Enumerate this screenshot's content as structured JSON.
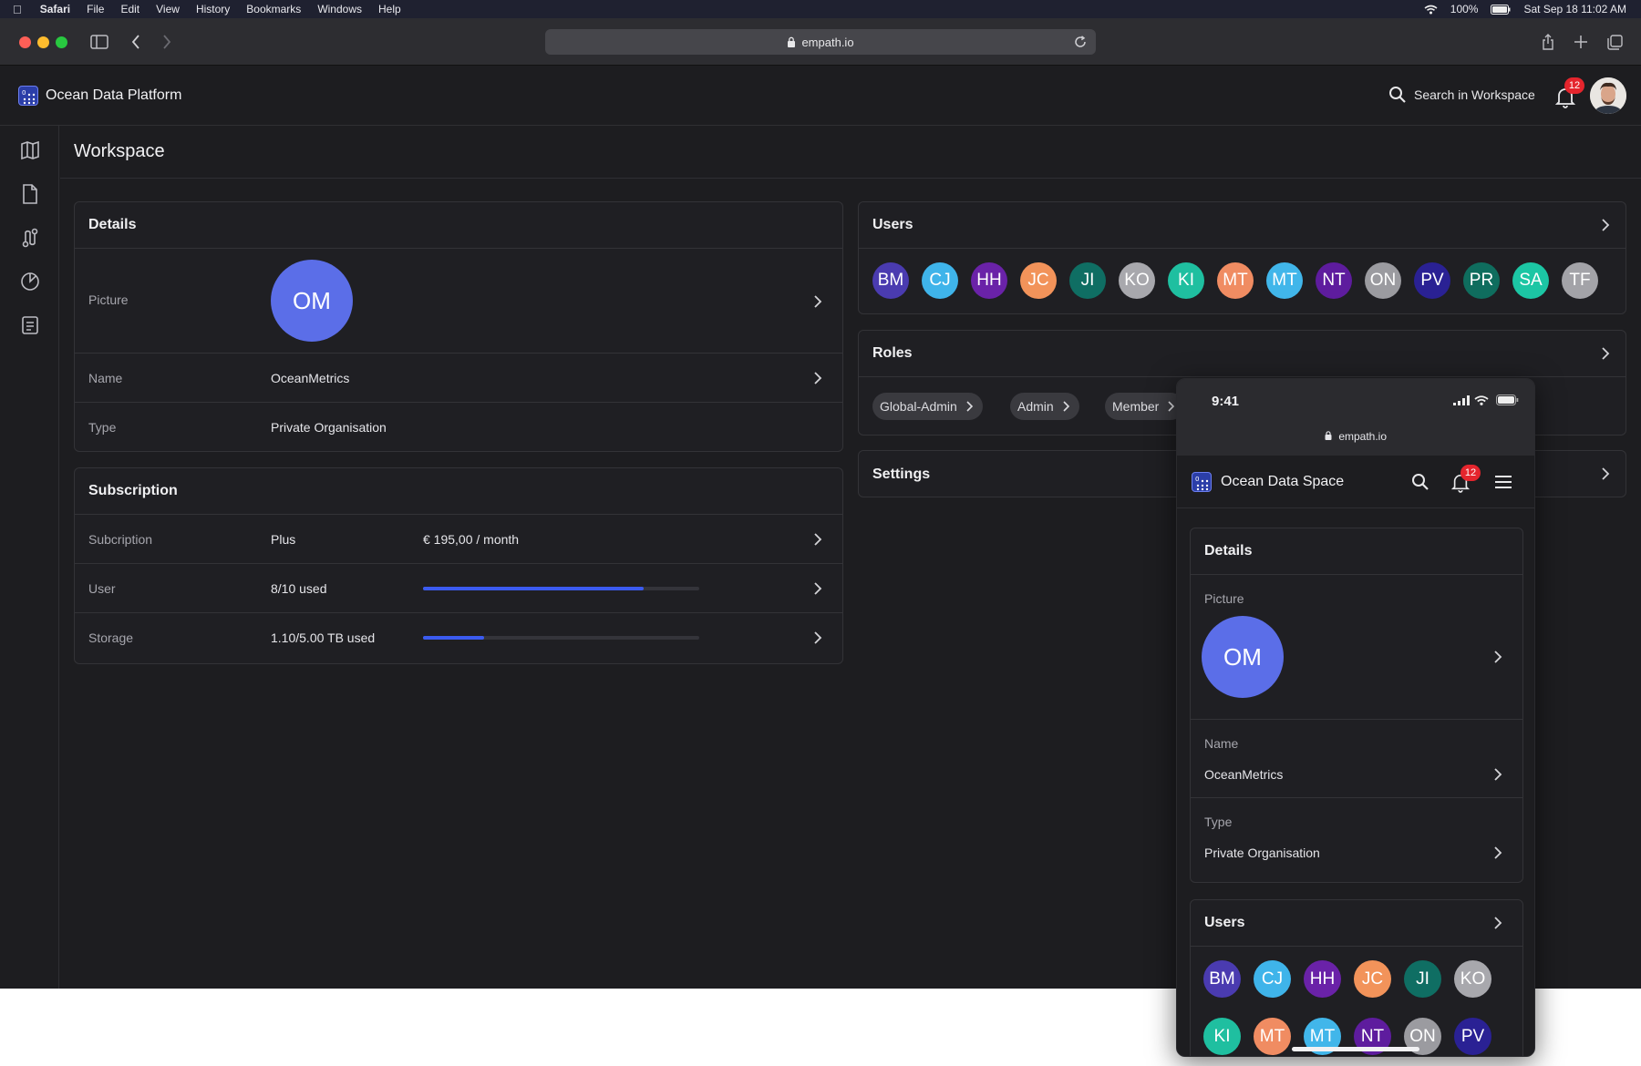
{
  "menubar": {
    "app": "Safari",
    "items": [
      "File",
      "Edit",
      "View",
      "History",
      "Bookmarks",
      "Windows",
      "Help"
    ],
    "battery": "100%",
    "datetime": "Sat Sep 18  11:02 AM"
  },
  "browser": {
    "url": "empath.io"
  },
  "app": {
    "brand": "Ocean Data Platform",
    "search_label": "Search in Workspace",
    "notifications": "12",
    "page_title": "Workspace",
    "sidebar_icons": [
      "map-icon",
      "document-icon",
      "route-icon",
      "pie-chart-icon",
      "report-icon"
    ]
  },
  "details": {
    "title": "Details",
    "picture_label": "Picture",
    "initials": "OM",
    "name_label": "Name",
    "name_value": "OceanMetrics",
    "type_label": "Type",
    "type_value": "Private Organisation"
  },
  "subscription": {
    "title": "Subscription",
    "plan_label": "Subcription",
    "plan_value": "Plus",
    "price": "€ 195,00 / month",
    "user_label": "User",
    "user_value": "8/10 used",
    "user_fraction": 0.8,
    "storage_label": "Storage",
    "storage_value": "1.10/5.00 TB used",
    "storage_fraction": 0.22
  },
  "users": {
    "title": "Users",
    "list": [
      {
        "initials": "BM",
        "color": "#4a3bb0"
      },
      {
        "initials": "CJ",
        "color": "#3fb4ea"
      },
      {
        "initials": "HH",
        "color": "#6a22a8"
      },
      {
        "initials": "JC",
        "color": "#f2935a"
      },
      {
        "initials": "JI",
        "color": "#0f6e63"
      },
      {
        "initials": "KO",
        "color": "#a8a8ad"
      },
      {
        "initials": "KI",
        "color": "#1fbfa0"
      },
      {
        "initials": "MT",
        "color": "#f08c62"
      },
      {
        "initials": "MT",
        "color": "#41b6ea"
      },
      {
        "initials": "NT",
        "color": "#5e1c9e"
      },
      {
        "initials": "ON",
        "color": "#9b9ba0"
      },
      {
        "initials": "PV",
        "color": "#2a2194"
      },
      {
        "initials": "PR",
        "color": "#0f6d5e"
      },
      {
        "initials": "SA",
        "color": "#1cc6a4"
      },
      {
        "initials": "TF",
        "color": "#a3a3a8"
      }
    ]
  },
  "roles": {
    "title": "Roles",
    "items": [
      "Global-Admin",
      "Admin",
      "Member"
    ]
  },
  "settings": {
    "title": "Settings"
  },
  "phone": {
    "time": "9:41",
    "url": "empath.io",
    "brand": "Ocean Data Space",
    "notifications": "12",
    "details_title": "Details",
    "picture_label": "Picture",
    "initials": "OM",
    "name_label": "Name",
    "name_value": "OceanMetrics",
    "type_label": "Type",
    "type_value": "Private Organisation",
    "users_title": "Users",
    "users": [
      {
        "initials": "BM",
        "color": "#4a3bb0"
      },
      {
        "initials": "CJ",
        "color": "#3fb4ea"
      },
      {
        "initials": "HH",
        "color": "#6a22a8"
      },
      {
        "initials": "JC",
        "color": "#f2935a"
      },
      {
        "initials": "JI",
        "color": "#0f6e63"
      },
      {
        "initials": "KO",
        "color": "#a8a8ad"
      },
      {
        "initials": "KI",
        "color": "#1fbfa0"
      },
      {
        "initials": "MT",
        "color": "#f08c62"
      },
      {
        "initials": "MT",
        "color": "#41b6ea"
      },
      {
        "initials": "NT",
        "color": "#5e1c9e"
      },
      {
        "initials": "ON",
        "color": "#9b9ba0"
      },
      {
        "initials": "PV",
        "color": "#2a2194"
      }
    ]
  },
  "colors": {
    "accent": "#3b5bf0",
    "avatar_org": "#5b6ee8",
    "badge": "#e5252d"
  }
}
